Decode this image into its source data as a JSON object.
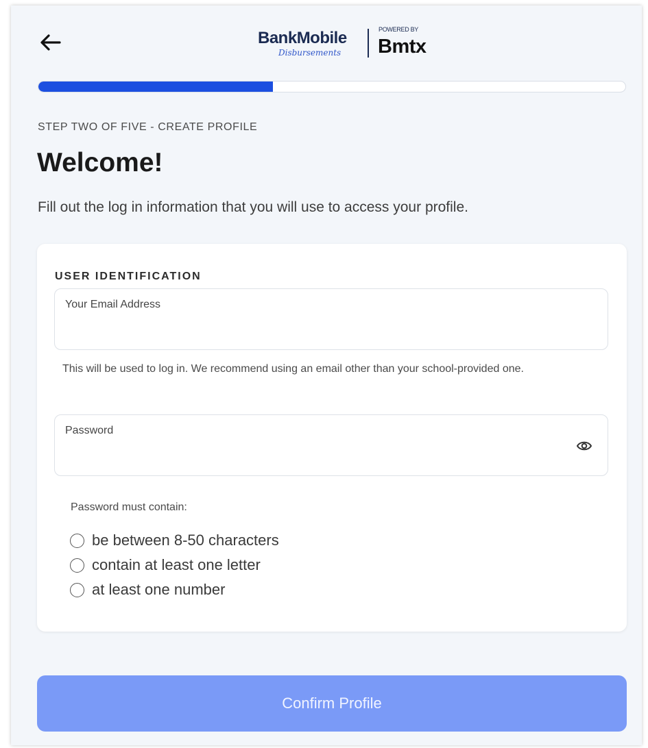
{
  "header": {
    "back_icon": "arrow-left-icon",
    "logo": {
      "brand": "BankMobile",
      "sub": "Disbursements",
      "powered_by": "POWERED BY",
      "partner": "Bmtx"
    }
  },
  "progress": {
    "current_step": 2,
    "total_steps": 5,
    "fraction": 0.4,
    "color": "#1c4fe0"
  },
  "step_label": "STEP TWO OF FIVE - CREATE PROFILE",
  "title": "Welcome!",
  "intro": "Fill out the log in information that you will use to access your profile.",
  "card": {
    "section_title": "USER IDENTIFICATION",
    "email": {
      "label": "Your Email Address",
      "value": ""
    },
    "email_helper": "This will be used to log in. We recommend using an email other than your school-provided one.",
    "password": {
      "label": "Password",
      "value": "",
      "toggle_icon": "eye-icon"
    },
    "rules_title": "Password must contain:",
    "rules": [
      {
        "label": "be between 8-50 characters",
        "met": false
      },
      {
        "label": "contain at least one letter",
        "met": false
      },
      {
        "label": "at least one number",
        "met": false
      }
    ]
  },
  "confirm_button": {
    "label": "Confirm Profile",
    "disabled": true,
    "color": "#7a9af7"
  }
}
